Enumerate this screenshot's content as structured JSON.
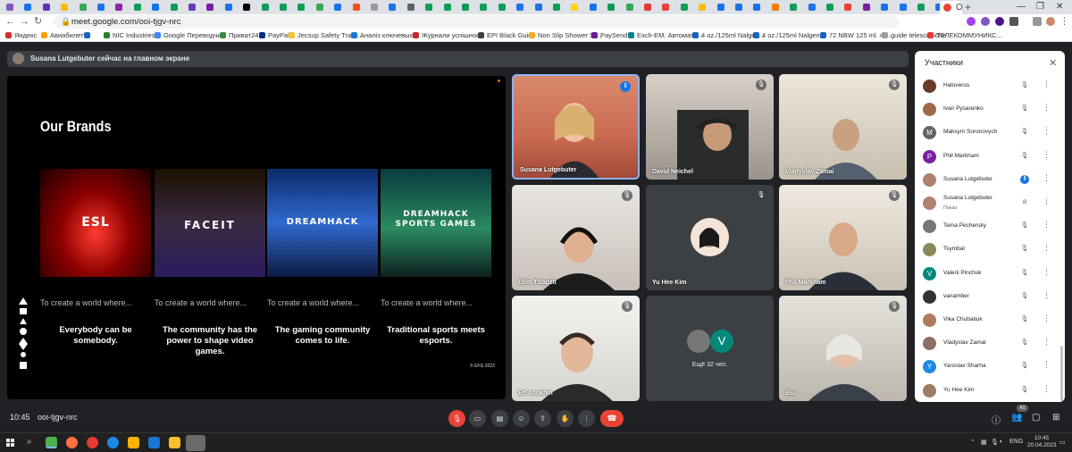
{
  "browser": {
    "active_tab_label": "O",
    "url": "meet.google.com/ooi-tjgv-nrc",
    "new_tab": "+",
    "bookmarks": [
      "Яндекс",
      "Авиабилеты",
      "",
      "NIC Industries",
      "Google Переводчик",
      "Приват24",
      "PayPal",
      "Jecsup Safety Track...",
      "Аналіз ключевых...",
      "Журнали успішності",
      "EPI Black Guide",
      "Non Slip Shower St...",
      "PaySend",
      "Exch-EM. Автомати...",
      "4 oz./125ml Nalgen...",
      "4 oz./125ml Nalgen...",
      "72 NBW 125 ml. 4o...",
      "guide telescopiche",
      "ТЕЛЕКОММУНИКС..."
    ]
  },
  "meet": {
    "presenter_banner": "Susana Lutgebuter сейчас на главном экране",
    "meeting_time": "10:45",
    "meeting_code": "ooi-tjgv-nrc",
    "people_count": "41",
    "slide": {
      "title": "Our Brands",
      "copyright": "© EFG 2022",
      "brands": [
        {
          "logo": "ESL",
          "caption": "To create a world where...",
          "text": "Everybody can be somebody."
        },
        {
          "logo": "FACEIT",
          "caption": "To create a world where...",
          "text": "The community has the power to shape video games."
        },
        {
          "logo": "DREAMHACK",
          "caption": "To create a world where...",
          "text": "The gaming community comes to life."
        },
        {
          "logo": "DREAMHACK SPORTS GAMES",
          "caption": "To create a world where...",
          "text": "Traditional sports meets esports."
        }
      ]
    },
    "tiles": [
      {
        "name": "Susana Lutgebuter",
        "speaking": true
      },
      {
        "name": "David Neichel",
        "speaking": false
      },
      {
        "name": "Vladyslav Zamai",
        "speaking": false
      },
      {
        "name": "Efim Tizagzit",
        "speaking": false
      },
      {
        "name": "Yu Hee Kim",
        "speaking": false
      },
      {
        "name": "Phil Markham",
        "speaking": false
      },
      {
        "name": "Ed Anokhin",
        "speaking": false
      },
      {
        "name": "Ещё 32 чел.",
        "speaking": false,
        "avatar_letter": "V"
      },
      {
        "name": "Вы",
        "speaking": false
      }
    ],
    "participants_panel": {
      "title": "Участники",
      "participants": [
        {
          "name": "Haloverus",
          "sub": "",
          "letter": "",
          "color": "#6b3b2a",
          "speaking": false
        },
        {
          "name": "Ivan Pysarenko",
          "sub": "",
          "letter": "",
          "color": "#a06a4a",
          "speaking": false
        },
        {
          "name": "Maksym Soronovych",
          "sub": "",
          "letter": "M",
          "color": "#5f6368",
          "speaking": false
        },
        {
          "name": "Phil Markham",
          "sub": "",
          "letter": "P",
          "color": "#7b1fa2",
          "speaking": false
        },
        {
          "name": "Susana Lutgebuter",
          "sub": "",
          "letter": "",
          "color": "#b08070",
          "speaking": true
        },
        {
          "name": "Susana Lutgebuter",
          "sub": "Показ",
          "letter": "",
          "color": "#b08070",
          "speaking": false
        },
        {
          "name": "Tema Pechersky",
          "sub": "",
          "letter": "",
          "color": "#777777",
          "speaking": false
        },
        {
          "name": "Tsymbal",
          "sub": "",
          "letter": "",
          "color": "#8a8a5a",
          "speaking": false
        },
        {
          "name": "Valerii Pinchuk",
          "sub": "",
          "letter": "V",
          "color": "#00897b",
          "speaking": false
        },
        {
          "name": "vanamber",
          "sub": "",
          "letter": "",
          "color": "#333333",
          "speaking": false
        },
        {
          "name": "Vika Chubatiuk",
          "sub": "",
          "letter": "",
          "color": "#b07a60",
          "speaking": false
        },
        {
          "name": "Vladyslav Zamai",
          "sub": "",
          "letter": "",
          "color": "#8d6e63",
          "speaking": false
        },
        {
          "name": "Yaroslav Sharha",
          "sub": "",
          "letter": "Y",
          "color": "#1e88e5",
          "speaking": false
        },
        {
          "name": "Yu Hee Kim",
          "sub": "",
          "letter": "",
          "color": "#9e7b65",
          "speaking": false
        }
      ]
    }
  },
  "taskbar": {
    "lang": "ENG",
    "time": "10:45",
    "date": "20.04.2023"
  }
}
